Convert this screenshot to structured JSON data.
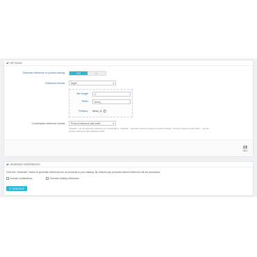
{
  "settings": {
    "title": "SETTINGS",
    "generate_label": "Generate reference on product saving:",
    "toggle_yes": "YES",
    "toggle_no": "NO",
    "reference_format_label": "Reference format:",
    "reference_format_value": "Digits",
    "min_length_label": "Min length",
    "min_length_value": "2",
    "prefix_label": "Prefix",
    "prefix_value": "demo_",
    "preview_label": "Preview:",
    "preview_value": "demo_11",
    "combination_label": "Combination reference format:",
    "combination_value": "Product reference with suffix",
    "help_line1": "\"Disable\" - do not generate reference for combinations; \"Regular\" - generate reference based on global settings; \"Product reference with suffix\" - use the",
    "help_line2": "product reference with additional suffix.",
    "save_label": "Save"
  },
  "generate": {
    "title": "GENERATE REFERENCES",
    "description": "Click the \"Generate\" button to generate references for all products in your catalog. By default only products without reference will be processed.",
    "include_combinations": "Include combinations",
    "override_existing": "Override existing references",
    "button_label": "GENERATE"
  },
  "colors": {
    "accent": "#25b9d7",
    "label_blue": "#2a6dab",
    "page_bg": "#eff1f2"
  }
}
